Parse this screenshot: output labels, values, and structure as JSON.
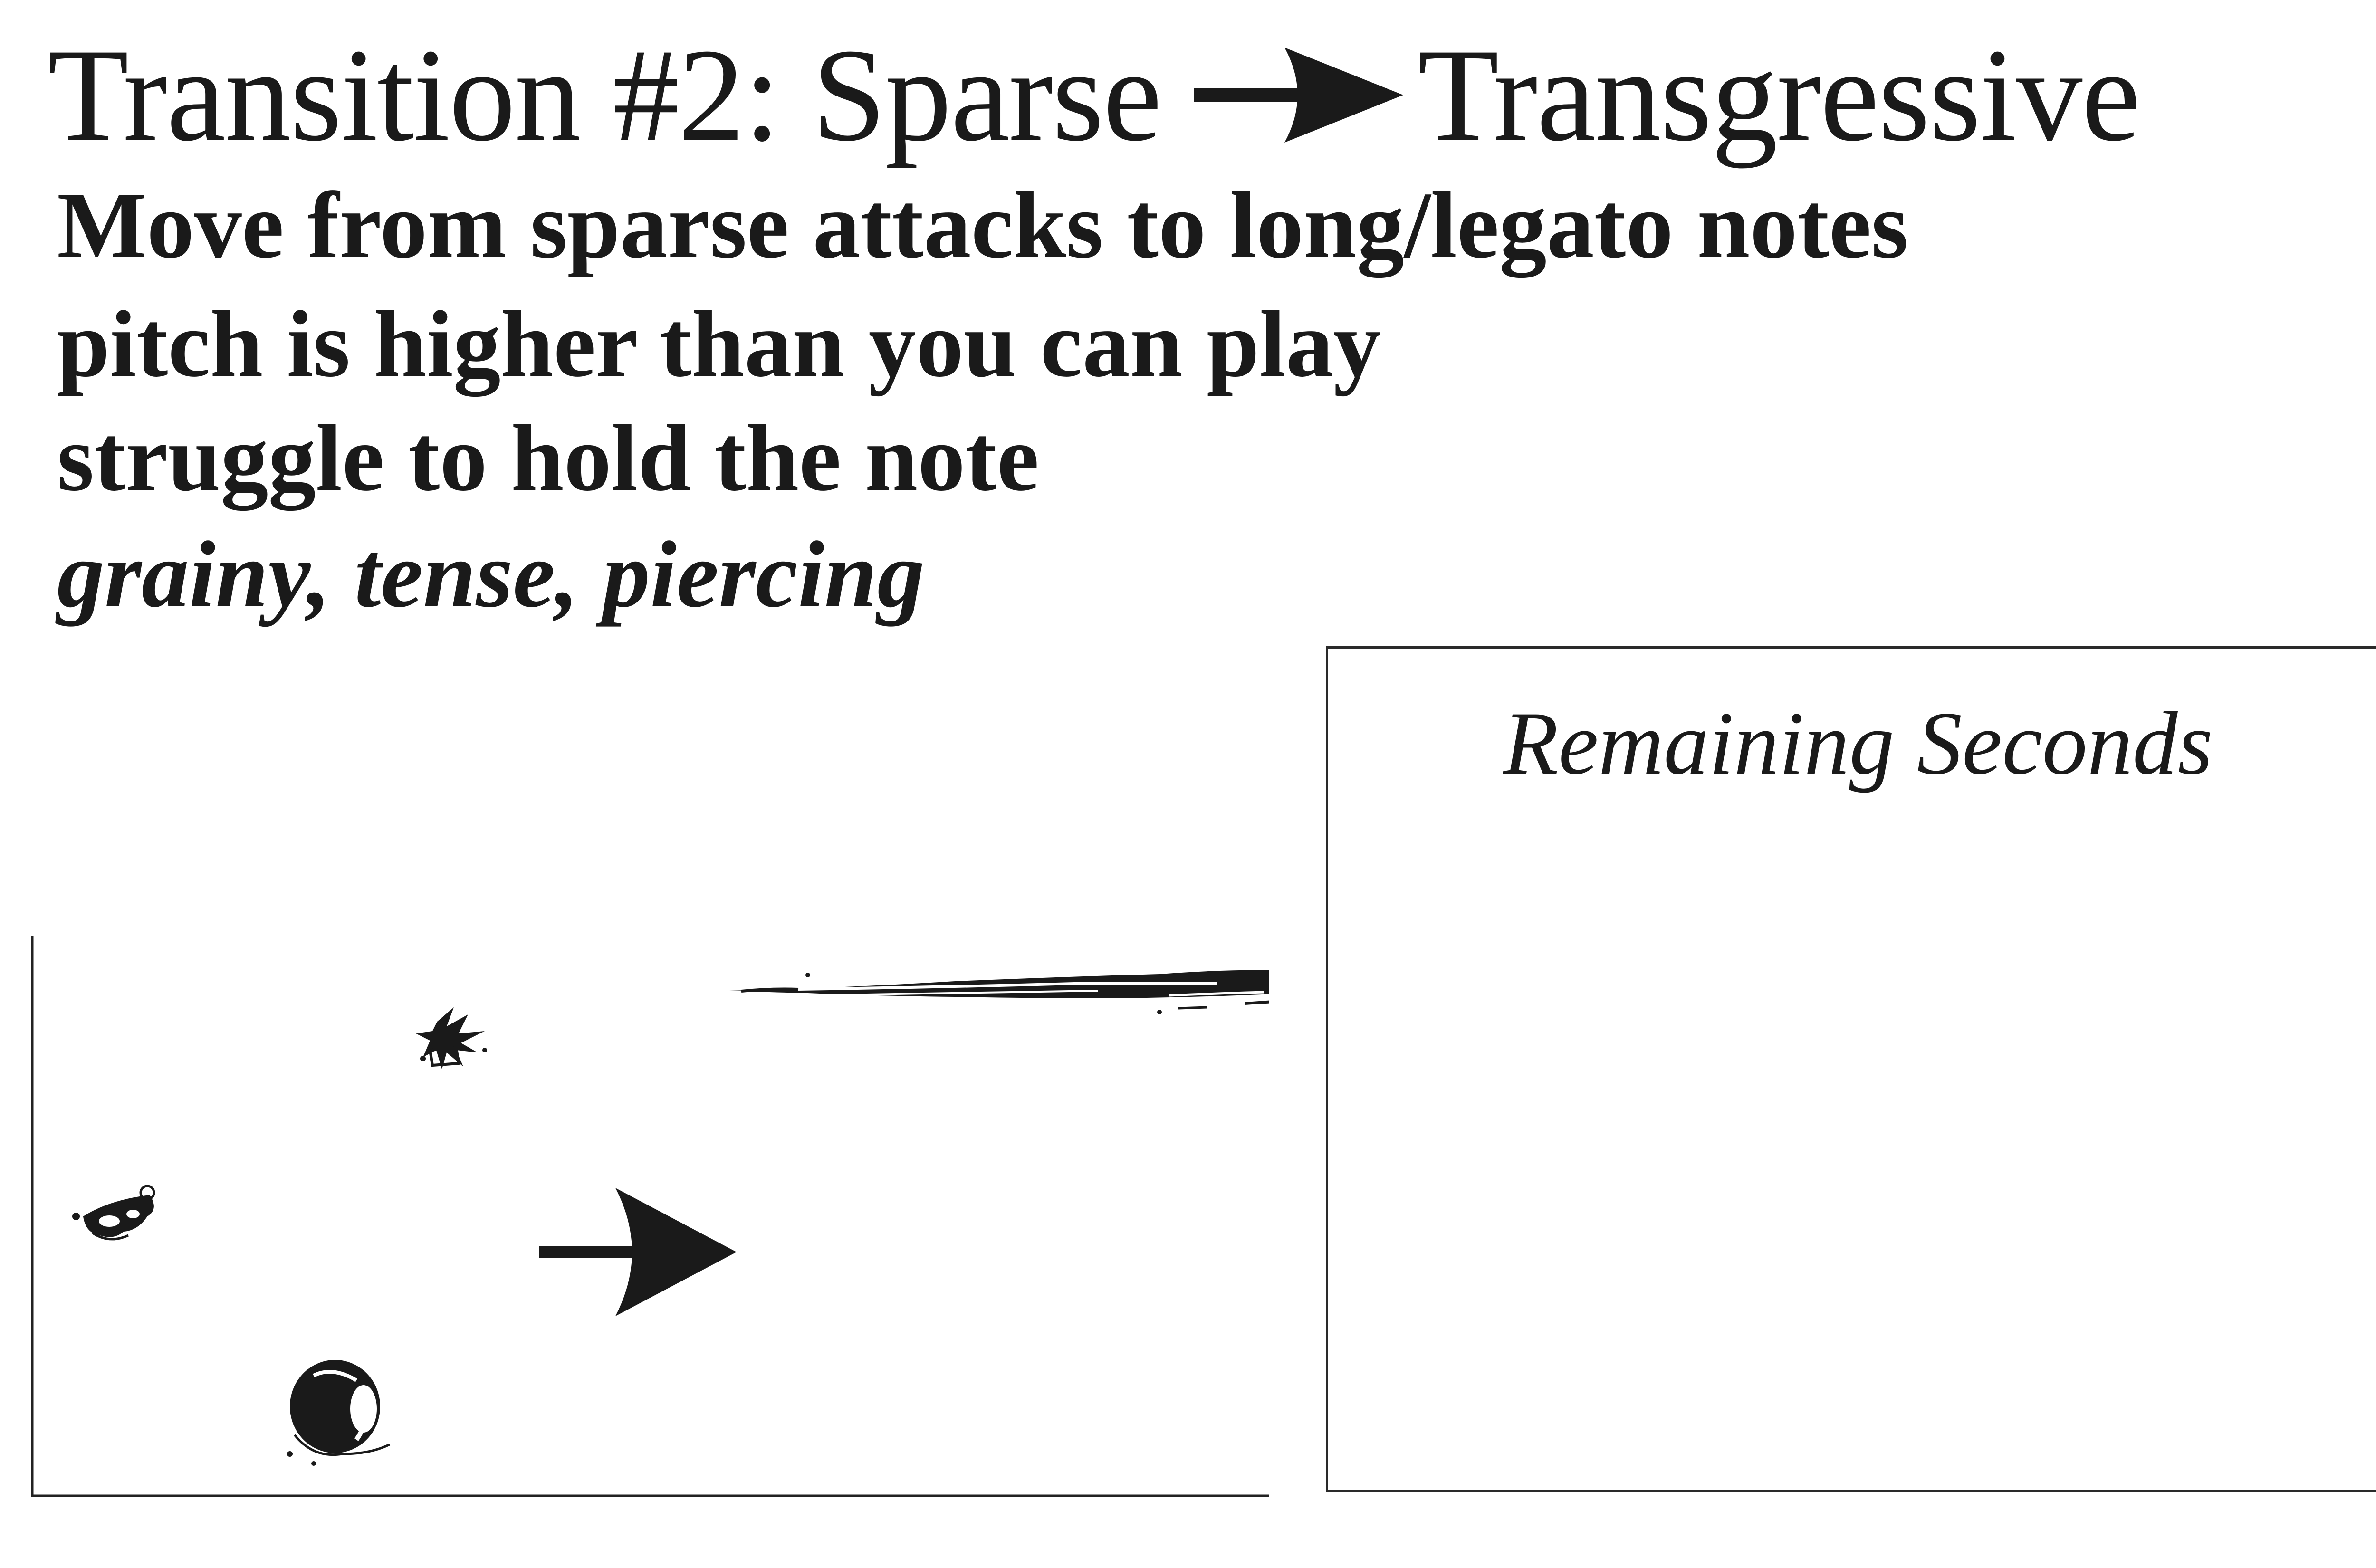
{
  "title": {
    "from": "Transition #2: Sparse",
    "to": "Transgressive",
    "arrow_icon": "right-arrow-icon"
  },
  "instructions": {
    "line1": "Move from sparse attacks to  long/legato notes",
    "line2": "pitch is higher than you can play",
    "line3": "struggle to hold the note",
    "qualities": "grainy, tense, piercing"
  },
  "timer": {
    "label": "Remaining Seconds"
  },
  "colors": {
    "ink": "#1a1a1a",
    "background": "#ffffff"
  }
}
